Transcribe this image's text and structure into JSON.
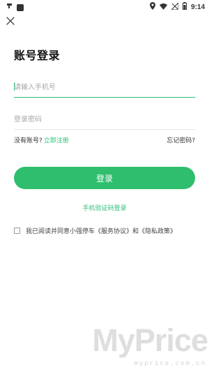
{
  "status_bar": {
    "left_icons": [
      "app-notification-icon",
      "square-icon"
    ],
    "right_icons": [
      "location-icon",
      "wifi-icon",
      "signal-off-icon",
      "battery-icon"
    ],
    "time": "9:14"
  },
  "page": {
    "title": "账号登录",
    "phone_placeholder": "请输入手机号",
    "password_placeholder": "登录密码",
    "no_account": "没有账号?",
    "register": "立即注册",
    "forgot": "忘记密码?",
    "login_button": "登录",
    "sms_login": "手机验证码登录",
    "agreement": "我已阅读并同意小强停车《服务协议》和《隐私政策》"
  },
  "watermark": {
    "big": "MyPrice",
    "small": "myprice.com.cn"
  },
  "colors": {
    "accent": "#2fbe6d",
    "link": "#2ec07a"
  }
}
